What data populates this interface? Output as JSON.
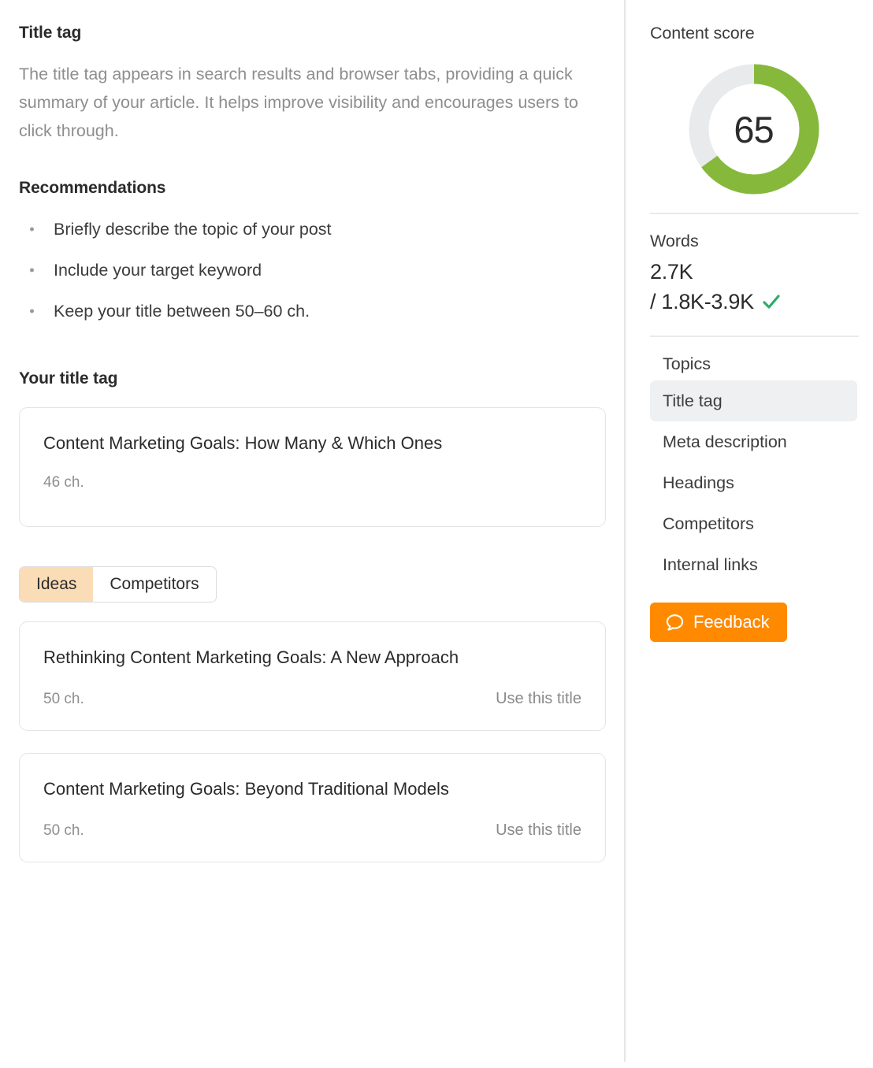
{
  "left": {
    "section_title": "Title tag",
    "section_description": "The title tag appears in search results and browser tabs, providing a quick summary of your article. It helps improve visibility and encourages users to click through.",
    "recommendations_heading": "Recommendations",
    "recommendations": [
      "Briefly describe the topic of your post",
      "Include your target keyword",
      "Keep your title between 50–60 ch."
    ],
    "your_title_heading": "Your title tag",
    "your_title": {
      "text": "Content Marketing Goals: How Many & Which Ones",
      "chars": "46 ch."
    },
    "tabs": [
      {
        "label": "Ideas",
        "active": true
      },
      {
        "label": "Competitors",
        "active": false
      }
    ],
    "ideas": [
      {
        "text": "Rethinking Content Marketing Goals: A New Approach",
        "chars": "50 ch.",
        "action": "Use this title"
      },
      {
        "text": "Content Marketing Goals: Beyond Traditional Models",
        "chars": "50 ch.",
        "action": "Use this title"
      }
    ]
  },
  "right": {
    "content_score_label": "Content score",
    "score": "65",
    "score_percent": 65,
    "words_label": "Words",
    "words_count": "2.7K",
    "words_range": "/ 1.8K-3.9K",
    "words_status_icon": "check-icon",
    "topics_label": "Topics",
    "topics": [
      {
        "label": "Title tag",
        "selected": true
      },
      {
        "label": "Meta description",
        "selected": false
      },
      {
        "label": "Headings",
        "selected": false
      },
      {
        "label": "Competitors",
        "selected": false
      },
      {
        "label": "Internal links",
        "selected": false
      }
    ],
    "feedback_label": "Feedback",
    "feedback_icon": "speech-bubble-icon"
  },
  "colors": {
    "score_arc": "#86b93b",
    "score_track": "#e9eaeb",
    "accent_orange": "#ff8a00",
    "tab_active_bg": "#fadcb6",
    "check_green": "#2eac68",
    "topic_selected_bg": "#eef0f1"
  }
}
